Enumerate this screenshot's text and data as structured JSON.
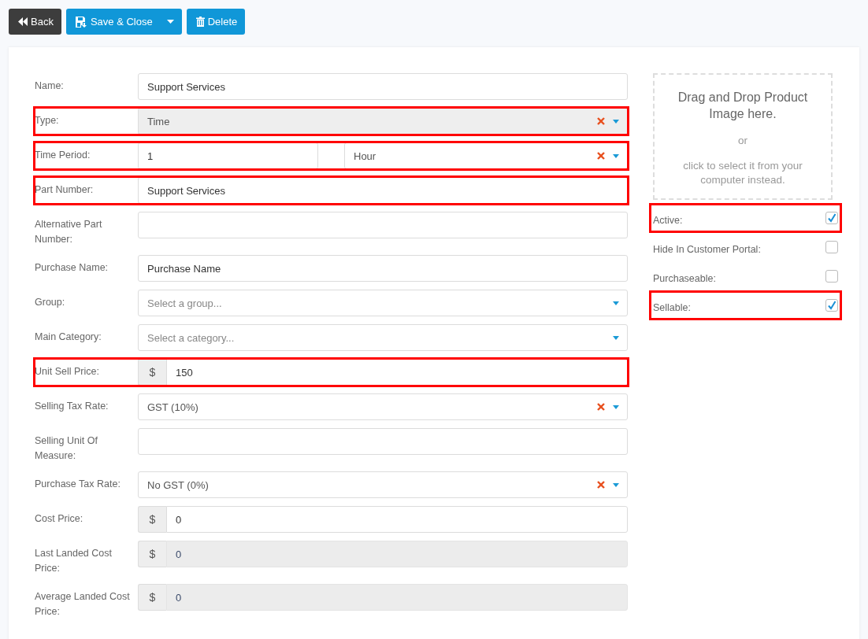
{
  "toolbar": {
    "back": "Back",
    "save": "Save & Close",
    "delete": "Delete"
  },
  "fields": [
    {
      "label": "Name:",
      "kind": "text",
      "value": "Support Services",
      "highlighted": false
    },
    {
      "label": "Type:",
      "kind": "select",
      "value": "Time",
      "disabled": true,
      "clearable": true,
      "highlighted": true
    },
    {
      "label": "Time Period:",
      "kind": "split",
      "value": "1",
      "select": "Hour",
      "clearable": true,
      "highlighted": true
    },
    {
      "label": "Part Number:",
      "kind": "text",
      "value": "Support Services",
      "highlighted": true
    },
    {
      "label": "Alternative Part Number:",
      "kind": "text",
      "highlighted": false
    },
    {
      "label": "Purchase Name:",
      "kind": "text",
      "value": "Purchase Name",
      "highlighted": false
    },
    {
      "label": "Group:",
      "kind": "select",
      "placeholder": "Select a group...",
      "clearable": false,
      "disabled": false,
      "highlighted": false
    },
    {
      "label": "Main Category:",
      "kind": "select",
      "placeholder": "Select a category...",
      "clearable": false,
      "disabled": false,
      "highlighted": false
    },
    {
      "label": "Unit Sell Price:",
      "kind": "money",
      "currency": "$",
      "value": "150",
      "disabled": false,
      "highlighted": true
    },
    {
      "label": "Selling Tax Rate:",
      "kind": "select",
      "value": "GST (10%)",
      "clearable": true,
      "disabled": false,
      "highlighted": false
    },
    {
      "label": "Selling Unit Of Measure:",
      "kind": "text",
      "highlighted": false
    },
    {
      "label": "Purchase Tax Rate:",
      "kind": "select",
      "value": "No GST (0%)",
      "clearable": true,
      "disabled": false,
      "highlighted": false
    },
    {
      "label": "Cost Price:",
      "kind": "money",
      "currency": "$",
      "value": "0",
      "disabled": false,
      "highlighted": false
    },
    {
      "label": "Last Landed Cost Price:",
      "kind": "money",
      "currency": "$",
      "value": "0",
      "disabled": true,
      "highlighted": false
    },
    {
      "label": "Average Landed Cost Price:",
      "kind": "money",
      "currency": "$",
      "value": "0",
      "disabled": true,
      "highlighted": false
    }
  ],
  "dropzone": {
    "title": "Drag and Drop Product Image here.",
    "or": "or",
    "hint": "click to select it from your computer instead."
  },
  "flags": [
    {
      "label": "Active:",
      "checked": true,
      "highlighted": true
    },
    {
      "label": "Hide In Customer Portal:",
      "checked": false,
      "highlighted": false
    },
    {
      "label": "Purchaseable:",
      "checked": false,
      "highlighted": false
    },
    {
      "label": "Sellable:",
      "checked": true,
      "highlighted": true
    }
  ]
}
